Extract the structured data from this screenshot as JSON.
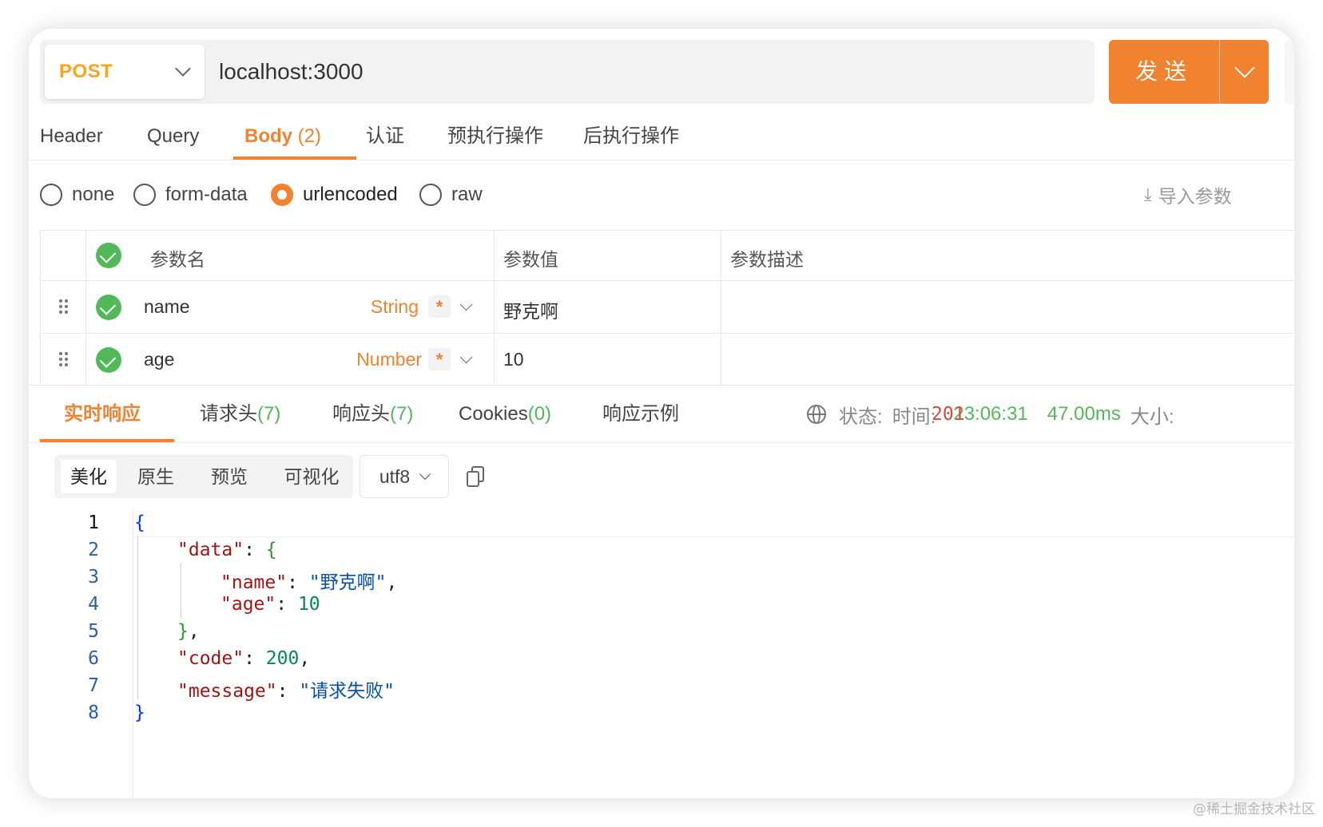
{
  "request": {
    "method": "POST",
    "url": "localhost:3000",
    "send_label": "发送"
  },
  "request_tabs": [
    {
      "label": "Header"
    },
    {
      "label": "Query"
    },
    {
      "label": "Body",
      "count": "(2)",
      "active": true
    },
    {
      "label": "认证"
    },
    {
      "label": "预执行操作"
    },
    {
      "label": "后执行操作"
    }
  ],
  "body_types": [
    {
      "label": "none",
      "selected": false
    },
    {
      "label": "form-data",
      "selected": false
    },
    {
      "label": "urlencoded",
      "selected": true
    },
    {
      "label": "raw",
      "selected": false
    }
  ],
  "import_label": "导入参数",
  "params_table": {
    "headers": [
      "参数名",
      "参数值",
      "参数描述"
    ],
    "rows": [
      {
        "name": "name",
        "type": "String",
        "required": "*",
        "value": "野克啊",
        "description": "",
        "enabled": true
      },
      {
        "name": "age",
        "type": "Number",
        "required": "*",
        "value": "10",
        "description": "",
        "enabled": true
      }
    ]
  },
  "response_tabs": [
    {
      "label": "实时响应",
      "active": true
    },
    {
      "label": "请求头",
      "count": "(7)"
    },
    {
      "label": "响应头",
      "count": "(7)"
    },
    {
      "label": "Cookies",
      "count": "(0)"
    },
    {
      "label": "响应示例"
    }
  ],
  "status": {
    "status_label": "状态:",
    "status_code": "201",
    "time_label": "时间:",
    "time_value": "23:06:31",
    "duration": "47.00ms",
    "size_label": "大小:"
  },
  "view_modes": [
    "美化",
    "原生",
    "预览",
    "可视化"
  ],
  "encoding": "utf8",
  "response_body_lines": [
    "1",
    "2",
    "3",
    "4",
    "5",
    "6",
    "7",
    "8"
  ],
  "response_json": {
    "key_data": "\"data\"",
    "key_name": "\"name\"",
    "val_name": "\"野克啊\"",
    "key_age": "\"age\"",
    "val_age": "10",
    "key_code": "\"code\"",
    "val_code": "200",
    "key_message": "\"message\"",
    "val_message": "\"请求失败\""
  },
  "watermark": "@稀土掘金技术社区",
  "colors": {
    "accent": "#f08230",
    "method": "#f5a623",
    "success": "#52b85a",
    "status_code": "#d34a3a"
  }
}
